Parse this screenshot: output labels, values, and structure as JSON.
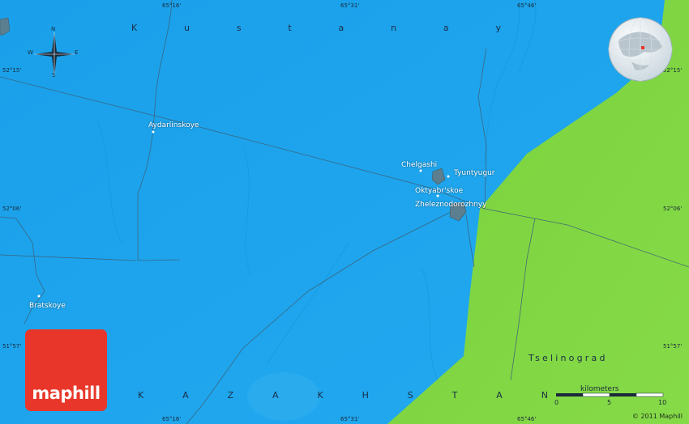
{
  "map": {
    "region_top": "Kustanay",
    "region_bottom": "KAZAKHSTAN",
    "region_right": "Tselinograd",
    "places": [
      {
        "name": "Aydarlinskoye"
      },
      {
        "name": "Chelgashi"
      },
      {
        "name": "Tyuntyugur"
      },
      {
        "name": "Oktyabr'skoe"
      },
      {
        "name": "Zheleznodorozhnyy"
      },
      {
        "name": "Bratskoye"
      }
    ],
    "coords": {
      "lon_1": "65°16'",
      "lon_2": "65°31'",
      "lon_3": "65°46'",
      "lat_1": "52°15'",
      "lat_2": "52°06'",
      "lat_3": "51°57'"
    },
    "compass": {
      "n": "N",
      "s": "S",
      "e": "E",
      "w": "W"
    },
    "scale": {
      "title": "kilometers",
      "ticks": [
        "0",
        "5",
        "10"
      ]
    },
    "logo": "maphill",
    "copyright": "© 2011 Maphill",
    "colors": {
      "water": "#1ea4ec",
      "land": "#7fd741",
      "settlement": "#5c7f8f",
      "logo": "#e8372a"
    }
  }
}
